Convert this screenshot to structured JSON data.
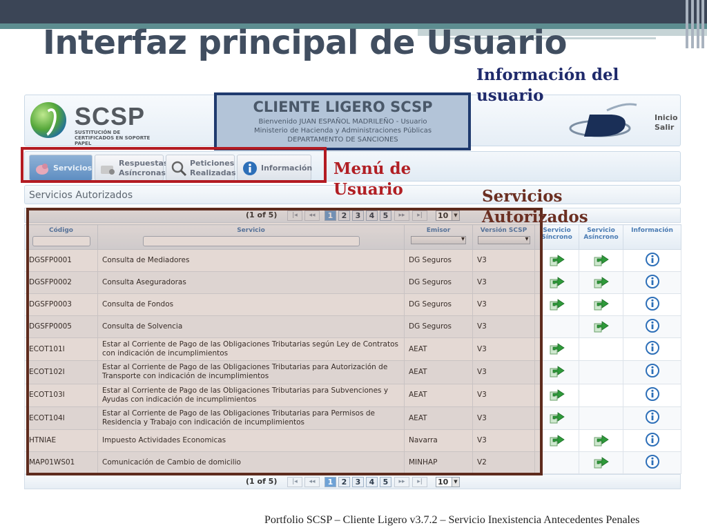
{
  "slide": {
    "title": "Interfaz principal de Usuario",
    "footer": "Portfolio SCSP – Cliente Ligero v3.7.2 – Servicio  Inexistencia Antecedentes Penales"
  },
  "callouts": {
    "user_info": "Información del usuario",
    "user_menu": "Menú de Usuario",
    "authorized_services": "Servicios Autorizados"
  },
  "header": {
    "logo_text": "SCSP",
    "logo_sub": "SUSTITUCIÓN DE CERTIFICADOS EN SOPORTE PAPEL",
    "banner_title": "CLIENTE LIGERO SCSP",
    "banner_line1": "Bienvenido JUAN ESPAÑOL MADRILEÑO - Usuario",
    "banner_line2": "Ministerio de Hacienda y Administraciones Públicas",
    "banner_line3": "DEPARTAMENTO DE SANCIONES",
    "link_inicio": "Inicio",
    "link_salir": "Salir"
  },
  "menu": {
    "servicios": "Servicios",
    "respuestas_1": "Respuestas",
    "respuestas_2": "Asíncronas",
    "peticiones_1": "Peticiones",
    "peticiones_2": "Realizadas",
    "informacion": "Información"
  },
  "section_title": "Servicios Autorizados",
  "pager": {
    "count": "(1 of 5)",
    "first": "|◂",
    "prev": "◂◂",
    "next": "▸▸",
    "last": "▸|",
    "pages": [
      "1",
      "2",
      "3",
      "4",
      "5"
    ],
    "page_size": "10"
  },
  "grid": {
    "headers": {
      "codigo": "Código",
      "servicio": "Servicio",
      "emisor": "Emisor",
      "version": "Versión SCSP",
      "sincrono_1": "Servicio",
      "sincrono_2": "Síncrono",
      "asincrono_1": "Servicio",
      "asincrono_2": "Asíncrono",
      "informacion": "Información"
    },
    "rows": [
      {
        "codigo": "DGSFP0001",
        "servicio": "Consulta de Mediadores",
        "emisor": "DG Seguros",
        "version": "V3",
        "sync": true,
        "async": true
      },
      {
        "codigo": "DGSFP0002",
        "servicio": "Consulta Aseguradoras",
        "emisor": "DG Seguros",
        "version": "V3",
        "sync": true,
        "async": true
      },
      {
        "codigo": "DGSFP0003",
        "servicio": "Consulta de Fondos",
        "emisor": "DG Seguros",
        "version": "V3",
        "sync": true,
        "async": true
      },
      {
        "codigo": "DGSFP0005",
        "servicio": "Consulta de Solvencia",
        "emisor": "DG Seguros",
        "version": "V3",
        "sync": false,
        "async": true
      },
      {
        "codigo": "ECOT101I",
        "servicio": "Estar al Corriente de Pago de las Obligaciones Tributarias según Ley de Contratos con indicación de incumplimientos",
        "emisor": "AEAT",
        "version": "V3",
        "sync": true,
        "async": false
      },
      {
        "codigo": "ECOT102I",
        "servicio": "Estar al Corriente de Pago de las Obligaciones Tributarias para Autorización de Transporte con indicación de incumplimientos",
        "emisor": "AEAT",
        "version": "V3",
        "sync": true,
        "async": false
      },
      {
        "codigo": "ECOT103I",
        "servicio": "Estar al Corriente de Pago de las Obligaciones Tributarias para Subvenciones y Ayudas con indicación de incumplimientos",
        "emisor": "AEAT",
        "version": "V3",
        "sync": true,
        "async": false
      },
      {
        "codigo": "ECOT104I",
        "servicio": "Estar al Corriente de Pago de las Obligaciones Tributarias para Permisos de Residencia y Trabajo con indicación de incumplimientos",
        "emisor": "AEAT",
        "version": "V3",
        "sync": true,
        "async": false
      },
      {
        "codigo": "HTNIAE",
        "servicio": "Impuesto Actividades Economicas",
        "emisor": "Navarra",
        "version": "V3",
        "sync": true,
        "async": true
      },
      {
        "codigo": "MAP01WS01",
        "servicio": "Comunicación de Cambio de domicilio",
        "emisor": "MINHAP",
        "version": "V2",
        "sync": false,
        "async": true
      }
    ]
  },
  "colors": {
    "callout_info": "#1f2a6b",
    "callout_menu": "#b11f24",
    "callout_services": "#6b2f22",
    "arrow_green": "#2e9a3a",
    "info_blue": "#2d6fb8"
  }
}
